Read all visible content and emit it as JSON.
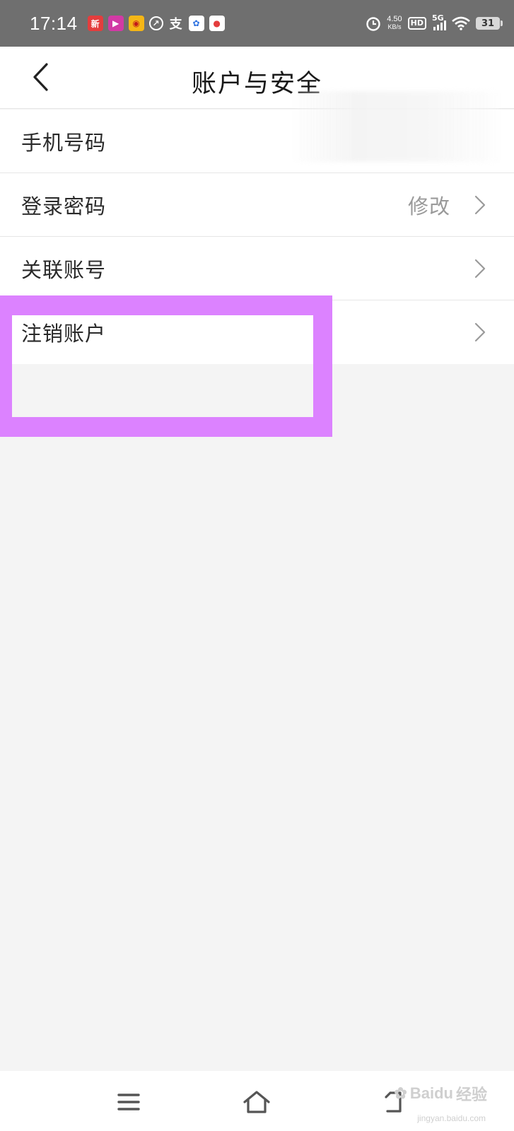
{
  "status_bar": {
    "time": "17:14",
    "net_speed_value": "4.50",
    "net_speed_unit": "KB/s",
    "hd_label": "HD",
    "network_label": "5G",
    "battery_level": "31",
    "notification_icons": [
      "news-app-icon",
      "video-app-icon",
      "weibo-icon",
      "speedometer-icon",
      "alipay-icon",
      "baidu-map-icon",
      "location-app-icon"
    ]
  },
  "header": {
    "title": "账户与安全"
  },
  "settings": {
    "items": [
      {
        "label": "手机号码",
        "value": ""
      },
      {
        "label": "登录密码",
        "value": "修改"
      },
      {
        "label": "关联账号",
        "value": ""
      },
      {
        "label": "注销账户",
        "value": ""
      }
    ]
  },
  "watermark": {
    "brand": "Baidu",
    "suffix": "经验",
    "url": "jingyan.baidu.com"
  },
  "colors": {
    "highlight": "#dc82ff",
    "status_bar_bg": "#6f6f6f",
    "page_bg": "#f4f4f4"
  }
}
